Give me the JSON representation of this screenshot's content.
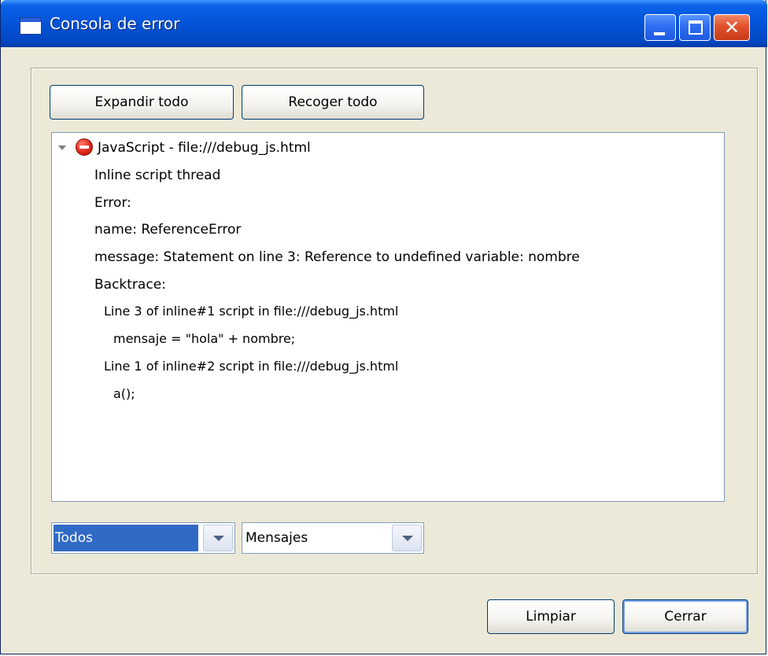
{
  "window": {
    "title": "Consola de error"
  },
  "toolbar": {
    "expand_label": "Expandir todo",
    "collapse_label": "Recoger todo"
  },
  "tree": {
    "root_label": "JavaScript - file:///debug_js.html",
    "root_icon": "error-icon",
    "lines": [
      "Inline script thread",
      "Error:",
      "name: ReferenceError",
      "message: Statement on line 3: Reference to undefined variable: nombre",
      "Backtrace:",
      "Line 3 of inline#1 script in file:///debug_js.html",
      "mensaje = \"hola\" + nombre;",
      "Line 1 of inline#2 script in file:///debug_js.html",
      "a();"
    ]
  },
  "filters": {
    "source_selected": "Todos",
    "type_selected": "Mensajes"
  },
  "actions": {
    "clear_label": "Limpiar",
    "close_label": "Cerrar"
  },
  "colors": {
    "title_bar": "#0453d7",
    "selection": "#316ac5",
    "close_button": "#e2502b",
    "dialog_background": "#ece9d8"
  }
}
